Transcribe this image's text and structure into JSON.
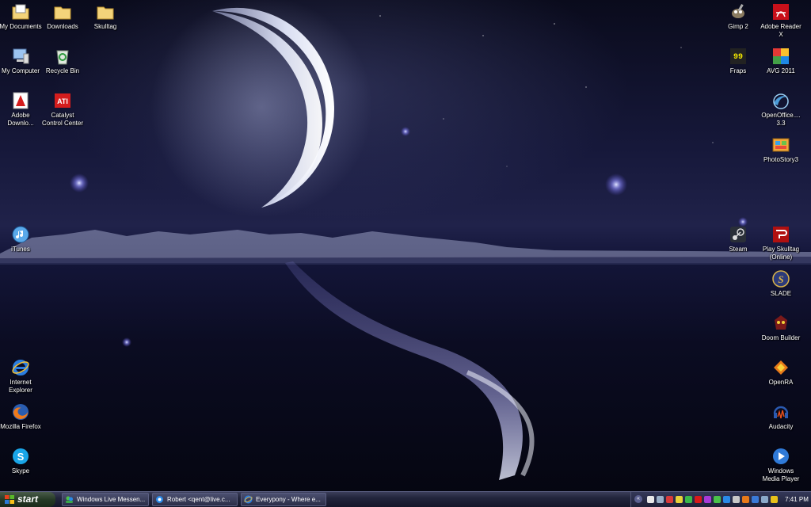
{
  "desktop_icons": [
    {
      "name": "my-documents",
      "label": "My Documents",
      "icon": "folder-documents-icon"
    },
    {
      "name": "downloads",
      "label": "Downloads",
      "icon": "folder-icon"
    },
    {
      "name": "skulltag-folder",
      "label": "Skulltag",
      "icon": "folder-icon"
    },
    {
      "name": "my-computer",
      "label": "My Computer",
      "icon": "computer-icon"
    },
    {
      "name": "recycle-bin",
      "label": "Recycle Bin",
      "icon": "recycle-bin-icon"
    },
    {
      "name": "adobe-download",
      "label": "Adobe\nDownlo...",
      "icon": "adobe-icon"
    },
    {
      "name": "catalyst",
      "label": "Catalyst\nControl Center",
      "icon": "ati-icon"
    },
    {
      "name": "itunes",
      "label": "iTunes",
      "icon": "itunes-icon"
    },
    {
      "name": "internet-explorer",
      "label": "Internet\nExplorer",
      "icon": "ie-icon"
    },
    {
      "name": "mozilla-firefox",
      "label": "Mozilla Firefox",
      "icon": "firefox-icon"
    },
    {
      "name": "skype",
      "label": "Skype",
      "icon": "skype-icon"
    },
    {
      "name": "gimp",
      "label": "Gimp 2",
      "icon": "gimp-icon"
    },
    {
      "name": "adobe-reader",
      "label": "Adobe Reader\nX",
      "icon": "adobe-reader-icon"
    },
    {
      "name": "fraps",
      "label": "Fraps",
      "icon": "fraps-icon"
    },
    {
      "name": "avg",
      "label": "AVG 2011",
      "icon": "avg-icon"
    },
    {
      "name": "openoffice",
      "label": "OpenOffice....\n3.3",
      "icon": "openoffice-icon"
    },
    {
      "name": "photostory",
      "label": "PhotoStory3",
      "icon": "photostory-icon"
    },
    {
      "name": "steam",
      "label": "Steam",
      "icon": "steam-icon"
    },
    {
      "name": "play-skulltag",
      "label": "Play Skulltag\n(Online)",
      "icon": "skulltag-icon"
    },
    {
      "name": "slade",
      "label": "SLADE",
      "icon": "slade-icon"
    },
    {
      "name": "doom-builder",
      "label": "Doom Builder",
      "icon": "doom-builder-icon"
    },
    {
      "name": "openra",
      "label": "OpenRA",
      "icon": "openra-icon"
    },
    {
      "name": "audacity",
      "label": "Audacity",
      "icon": "audacity-icon"
    },
    {
      "name": "windows-media-player",
      "label": "Windows\nMedia Player",
      "icon": "media-player-icon"
    }
  ],
  "taskbar": {
    "start_label": "start",
    "tasks": [
      {
        "label": "Windows Live Messen...",
        "icon": "messenger-icon"
      },
      {
        "label": "Robert <qent@live.c...",
        "icon": "messenger-chat-icon"
      },
      {
        "label": "Everypony - Where e...",
        "icon": "ie-icon"
      }
    ],
    "tray_chevron": "«",
    "clock": "7:41 PM"
  },
  "colors": {
    "taskbar": "#22253c",
    "start_button": "#263a26",
    "text": "#ffffff"
  }
}
